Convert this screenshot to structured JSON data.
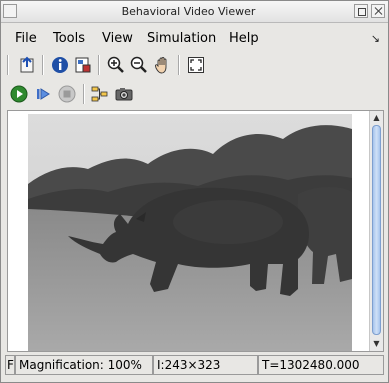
{
  "window": {
    "title": "Behavioral Video Viewer"
  },
  "menu": {
    "items": [
      "File",
      "Tools",
      "View",
      "Simulation",
      "Help"
    ]
  },
  "toolbar1": {
    "icons": [
      "open-file-icon",
      "info-icon",
      "properties-icon",
      "zoom-in-icon",
      "zoom-out-icon",
      "pan-hand-icon",
      "fit-to-window-icon"
    ]
  },
  "toolbar2": {
    "icons": [
      "play-icon",
      "step-forward-icon",
      "stop-icon",
      "flow-settings-icon",
      "camera-icon"
    ]
  },
  "status": {
    "prefix": "F",
    "magnification": "Magnification: 100%",
    "image_size": "I:243×323",
    "time": "T=1302480.000"
  },
  "colors": {
    "accent": "#2f8a2f",
    "scroll_thumb": "#a5c3ec"
  }
}
